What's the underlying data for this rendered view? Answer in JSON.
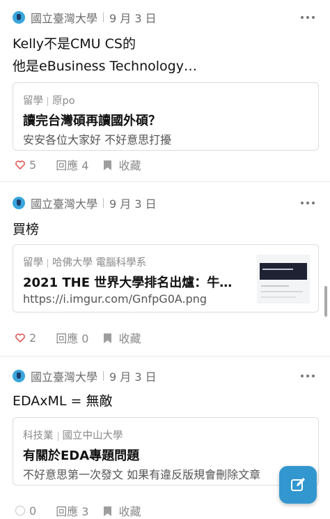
{
  "colors": {
    "accent": "#3397cf",
    "heart_red": "#e05a5a",
    "meta_gray": "#6b6b6b",
    "divider": "#e7e7e7"
  },
  "posts": [
    {
      "school": "國立臺灣大學",
      "date": "9 月 3 日",
      "title_lines": [
        "Kelly不是CMU CS的",
        "他是eBusiness Technology…"
      ],
      "card": {
        "category": "留學",
        "tag": "原po",
        "title": "讀完台灣碩再讀國外碩？",
        "subtitle": "安安各位大家好 不好意思打擾"
      },
      "reaction_icon": "heart-icon",
      "likes": "5",
      "replies": "回應 4",
      "save": "收藏"
    },
    {
      "school": "國立臺灣大學",
      "date": "9 月 3 日",
      "title_lines": [
        "買榜"
      ],
      "card": {
        "category": "留學",
        "tag": "哈佛大學 電腦科學系",
        "title": "2021 THE 世界大學排名出爐：牛…",
        "subtitle": "https://i.imgur.com/GnfpG0A.png"
      },
      "reaction_icon": "heart-icon",
      "likes": "2",
      "replies": "回應 0",
      "save": "收藏"
    },
    {
      "school": "國立臺灣大學",
      "date": "9 月 3 日",
      "title_lines": [
        "EDAxML = 無敵"
      ],
      "card": {
        "category": "科技業",
        "tag": "國立中山大學",
        "title": "有關於EDA專題問題",
        "subtitle": "不好意思第一次發文 如果有違反版規會刪除文章"
      },
      "reaction_icon": "smile-icon",
      "likes": "0",
      "replies": "回應 3",
      "save": "收藏"
    }
  ],
  "fab_icon": "compose-icon"
}
